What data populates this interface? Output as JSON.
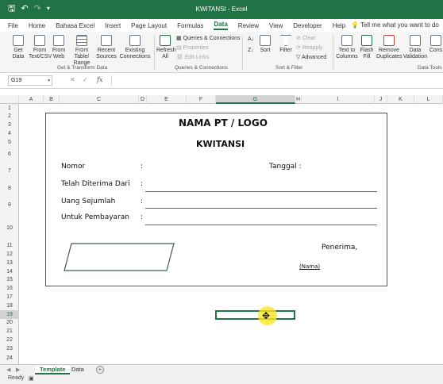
{
  "app": {
    "title": "KWITANSI  -  Excel",
    "tell_me": "Tell me what you want to do"
  },
  "tabs": [
    "File",
    "Home",
    "Bahasa Excel",
    "Insert",
    "Page Layout",
    "Formulas",
    "Data",
    "Review",
    "View",
    "Developer",
    "Help"
  ],
  "active_tab": "Data",
  "ribbon": {
    "get_data": "Get",
    "get_data2": "Data",
    "from_text": "From",
    "from_text2": "Text/CSV",
    "from_web": "From",
    "from_web2": "Web",
    "from_table": "From Table/",
    "from_table2": "Range",
    "recent_sources": "Recent",
    "recent_sources2": "Sources",
    "existing_connections": "Existing",
    "existing_connections2": "Connections",
    "group_get_transform": "Get & Transform Data",
    "refresh_all": "Refresh",
    "refresh_all2": "All",
    "queries_connections": "Queries & Connections",
    "properties": "Properties",
    "edit_links": "Edit Links",
    "group_queries": "Queries & Connections",
    "sort": "Sort",
    "filter": "Filter",
    "clear": "Clear",
    "reapply": "Reapply",
    "advanced": "Advanced",
    "group_sort_filter": "Sort & Filter",
    "text_to_columns": "Text to",
    "text_to_columns2": "Columns",
    "flash_fill": "Flash",
    "flash_fill2": "Fill",
    "remove_duplicates": "Remove",
    "remove_duplicates2": "Duplicates",
    "data_validation": "Data",
    "data_validation2": "Validation",
    "consolidate": "Cons",
    "group_data_tools": "Data Tools"
  },
  "formula_bar": {
    "name_box": "G19",
    "cancel": "✕",
    "enter": "✓",
    "fx": "fx",
    "value": ""
  },
  "columns": [
    "A",
    "B",
    "C",
    "D",
    "E",
    "F",
    "G",
    "H",
    "I",
    "J",
    "K",
    "L"
  ],
  "selected_column": "G",
  "rows": [
    "1",
    "2",
    "3",
    "4",
    "5",
    "6",
    "7",
    "8",
    "9",
    "10",
    "11",
    "12",
    "13",
    "14",
    "15",
    "16",
    "17",
    "18",
    "19",
    "20",
    "21",
    "22",
    "23",
    "24"
  ],
  "selected_row": "19",
  "receipt": {
    "company": "NAMA PT / LOGO",
    "title": "KWITANSI",
    "nomor_label": "Nomor",
    "colon": ":",
    "tanggal_label": "Tanggal :",
    "diterima_label": "Telah Diterima Dari",
    "uang_label": "Uang Sejumlah",
    "pembayaran_label": "Untuk Pembayaran",
    "penerima_label": "Penerima,",
    "nama_label": "(Nama)"
  },
  "sheets": [
    "Template",
    "Data"
  ],
  "active_sheet": "Template",
  "status": {
    "ready": "Ready"
  },
  "colors": {
    "excel_green": "#217346",
    "highlight": "#fae628"
  }
}
